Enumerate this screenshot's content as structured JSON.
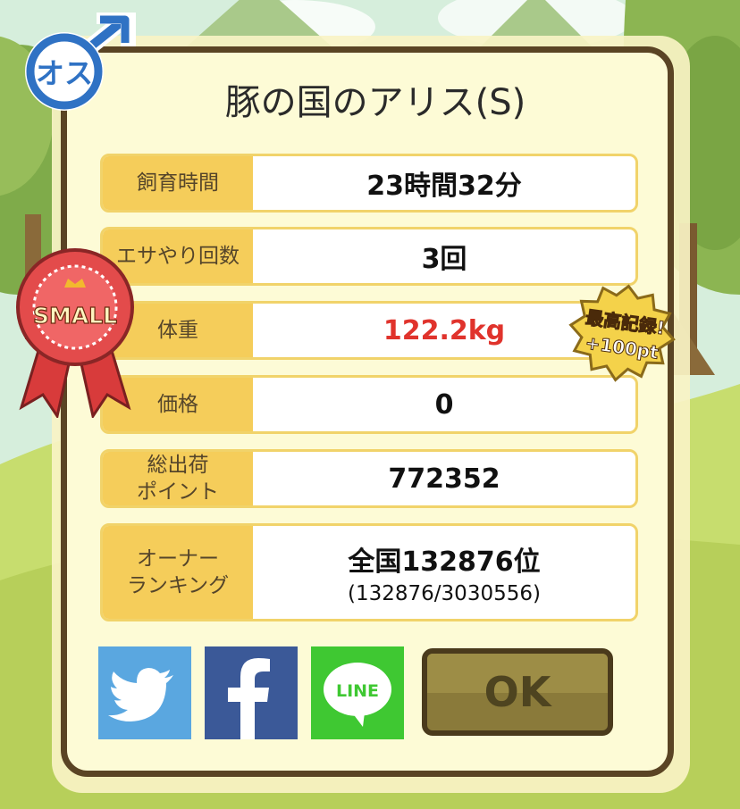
{
  "title": "豚の国のアリス(S)",
  "gender_badge": {
    "text": "オス",
    "icon": "male-symbol-icon"
  },
  "size_ribbon": {
    "text": "SMALL"
  },
  "record_badge": {
    "line1": "最高記録!",
    "line2": "+100pt"
  },
  "stats": {
    "feeding_time": {
      "label": "飼育時間",
      "value": "23時間32分"
    },
    "feed_count": {
      "label": "エサやり回数",
      "value": "3回"
    },
    "weight": {
      "label": "体重",
      "value": "122.2kg"
    },
    "price": {
      "label": "価格",
      "value": "0"
    },
    "shipping_points": {
      "label_line1": "総出荷",
      "label_line2": "ポイント",
      "value": "772352"
    },
    "owner_ranking": {
      "label_line1": "オーナー",
      "label_line2": "ランキング",
      "value": "全国132876位",
      "detail": "(132876/3030556)"
    }
  },
  "share": {
    "twitter_icon": "twitter-bird-icon",
    "facebook_icon": "facebook-f-icon",
    "line_text": "LINE"
  },
  "ok_label": "OK",
  "colors": {
    "label_bg": "#f5cd5a",
    "panel_border": "#5a4424",
    "weight_red": "#e0332c",
    "twitter": "#5aa7e0",
    "facebook": "#3b5998",
    "line": "#3fc832"
  }
}
